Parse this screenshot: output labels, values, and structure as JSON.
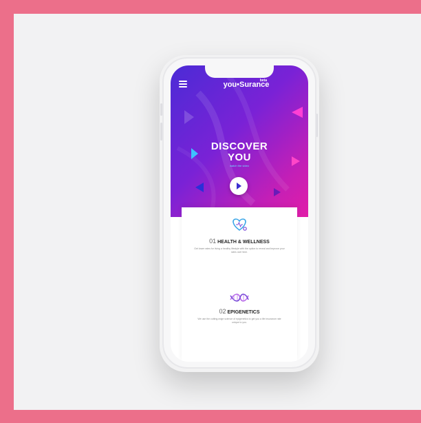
{
  "app": {
    "logo_text": "you•Surance",
    "logo_tag": "beta"
  },
  "hero": {
    "title_line1": "DISCOVER",
    "title_line2": "YOU",
    "subtitle": "watch the video"
  },
  "features": [
    {
      "number": "01",
      "name": "HEALTH & WELLNESS",
      "description": "Get lower rates for living a healthy lifestyle with the option to reveal and improve your rates over time."
    },
    {
      "number": "02",
      "name": "EPIGENETICS",
      "description": "We use the cutting-edge science of epigenetics to get you a life insurance rate unique to you."
    }
  ],
  "colors": {
    "border": "#ec6f8a",
    "gradient_start": "#4b2bd6",
    "gradient_end": "#e11ea8",
    "accent": "#6fe3ff"
  },
  "icons": {
    "menu": "hamburger-menu-icon",
    "play": "play-icon",
    "health": "heart-stethoscope-icon",
    "dna": "dna-icon"
  }
}
